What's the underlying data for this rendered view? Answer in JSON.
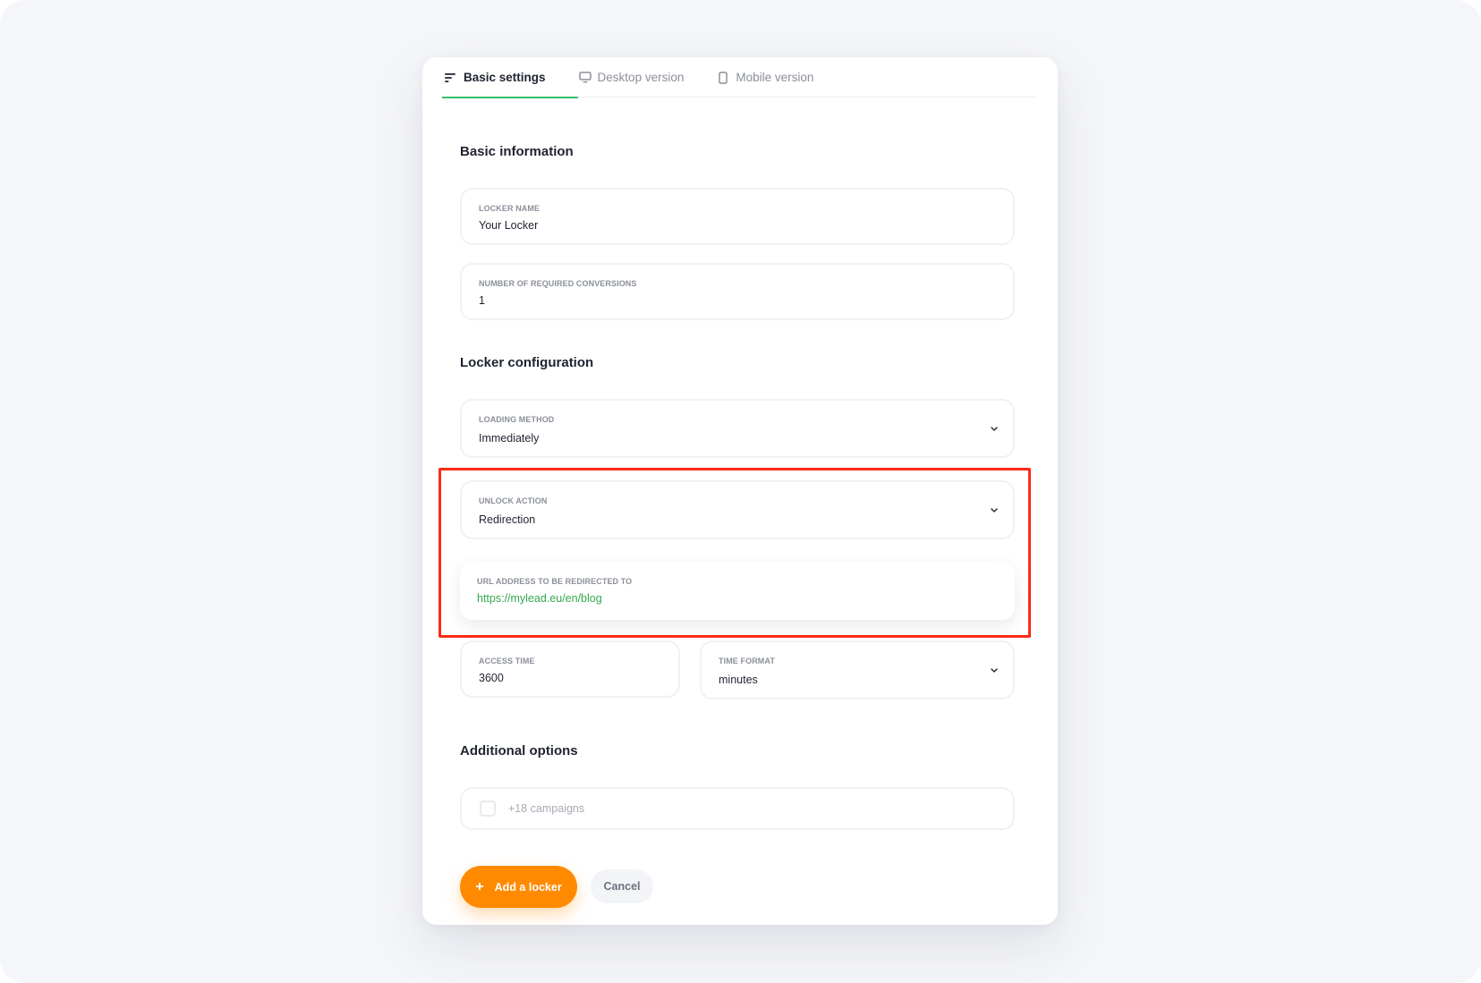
{
  "tabs": [
    {
      "label": "Basic settings",
      "icon": "list-icon",
      "active": true
    },
    {
      "label": "Desktop version",
      "icon": "desktop-icon",
      "active": false
    },
    {
      "label": "Mobile version",
      "icon": "mobile-icon",
      "active": false
    }
  ],
  "sections": {
    "basic_information": "Basic information",
    "locker_configuration": "Locker configuration",
    "additional_options": "Additional options"
  },
  "fields": {
    "locker_name": {
      "label": "LOCKER NAME",
      "value": "Your Locker"
    },
    "required_conversions": {
      "label": "NUMBER OF REQUIRED CONVERSIONS",
      "value": "1"
    },
    "loading_method": {
      "label": "LOADING METHOD",
      "value": "Immediately"
    },
    "unlock_action": {
      "label": "UNLOCK ACTION",
      "value": "Redirection"
    },
    "redirect_url": {
      "label": "URL ADDRESS TO BE REDIRECTED TO",
      "value": "https://mylead.eu/en/blog"
    },
    "access_time": {
      "label": "ACCESS TIME",
      "value": "3600"
    },
    "time_format": {
      "label": "TIME FORMAT",
      "value": "minutes"
    }
  },
  "additional": {
    "checkbox_label": "+18 campaigns",
    "checked": false
  },
  "buttons": {
    "add_label": "Add a locker",
    "cancel_label": "Cancel"
  },
  "colors": {
    "accent_green": "#34c06a",
    "primary_orange": "#ff8a00",
    "highlight_red": "#ff2a16",
    "link_green": "#34a84e"
  }
}
